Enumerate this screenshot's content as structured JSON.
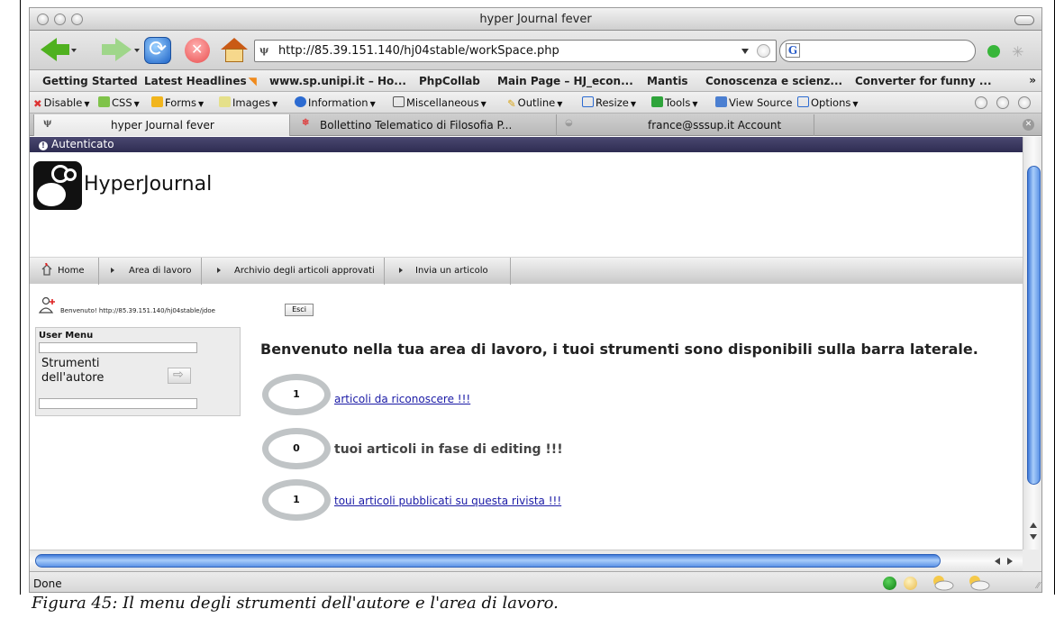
{
  "window": {
    "title": "hyper Journal fever"
  },
  "toolbar": {
    "url": "http://85.39.151.140/hj04stable/workSpace.php",
    "url_favicon": "ψ",
    "search_engine_glyph": "G"
  },
  "bookmarks": [
    "Getting Started",
    "Latest Headlines",
    "www.sp.unipi.it – Ho...",
    "PhpCollab",
    "Main Page – HJ_econ...",
    "Mantis",
    "Conoscenza e scienz...",
    "Converter for funny ..."
  ],
  "bookmarks_more": "»",
  "webdev": [
    "Disable",
    "CSS",
    "Forms",
    "Images",
    "Information",
    "Miscellaneous",
    "Outline",
    "Resize",
    "Tools",
    "View Source",
    "Options"
  ],
  "tabs": [
    {
      "label": "hyper Journal fever",
      "active": true
    },
    {
      "label": "Bollettino Telematico di Filosofia P...",
      "active": false
    },
    {
      "label": "france@sssup.it Account",
      "active": false
    }
  ],
  "page": {
    "auth_status": "Autenticato",
    "logo_text": "HyperJournal",
    "nav": [
      "Home",
      "Area di lavoro",
      "Archivio degli articoli approvati",
      "Invia un articolo"
    ],
    "welcome": "Benvenuto! http://85.39.151.140/hj04stable/jdoe",
    "logout_label": "Esci",
    "user_menu_title": "User Menu",
    "user_menu_item": "Strumenti dell'autore",
    "headline": "Benvenuto nella tua area di lavoro, i tuoi strumenti sono disponibili sulla barra laterale.",
    "items": [
      {
        "count": "1",
        "label": "articoli da riconoscere !!!",
        "is_link": true
      },
      {
        "count": "0",
        "label": "tuoi articoli in fase di editing !!!",
        "is_link": false
      },
      {
        "count": "1",
        "label": "toui articoli pubblicati su questa rivista !!!",
        "is_link": true
      }
    ]
  },
  "status": {
    "text": "Done"
  },
  "caption": "Figura 45: Il menu degli strumenti dell'autore e l'area di lavoro.",
  "colors": {
    "auth_bar": "#2e2c52",
    "link": "#1a1aa6",
    "scroll_thumb": "#3d78d8"
  }
}
